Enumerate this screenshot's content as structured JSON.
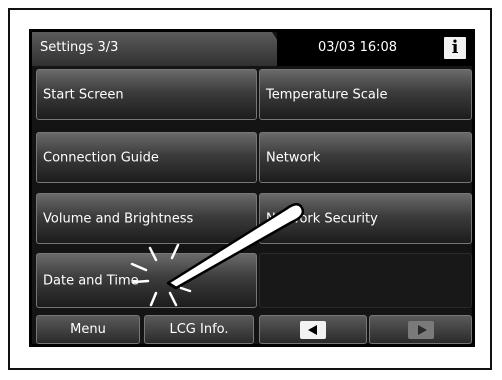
{
  "header": {
    "title": "Settings 3/3",
    "datetime": "03/03 16:08",
    "info_label": "i"
  },
  "menu": {
    "items": [
      {
        "label": "Start Screen"
      },
      {
        "label": "Temperature Scale"
      },
      {
        "label": "Connection Guide"
      },
      {
        "label": "Network"
      },
      {
        "label": "Volume and Brightness"
      },
      {
        "label": "Network Security"
      },
      {
        "label": "Date and Time"
      }
    ]
  },
  "footer": {
    "menu_label": "Menu",
    "lcg_label": "LCG Info."
  },
  "icons": {
    "prev": "left-arrow-icon",
    "next": "right-arrow-icon",
    "stylus": "stylus-icon",
    "tap": "tap-burst-icon"
  },
  "colors": {
    "screen_bg": "#141414",
    "button_top": "#6a6a6a",
    "button_bottom": "#1c1c1c",
    "text": "#ffffff"
  }
}
